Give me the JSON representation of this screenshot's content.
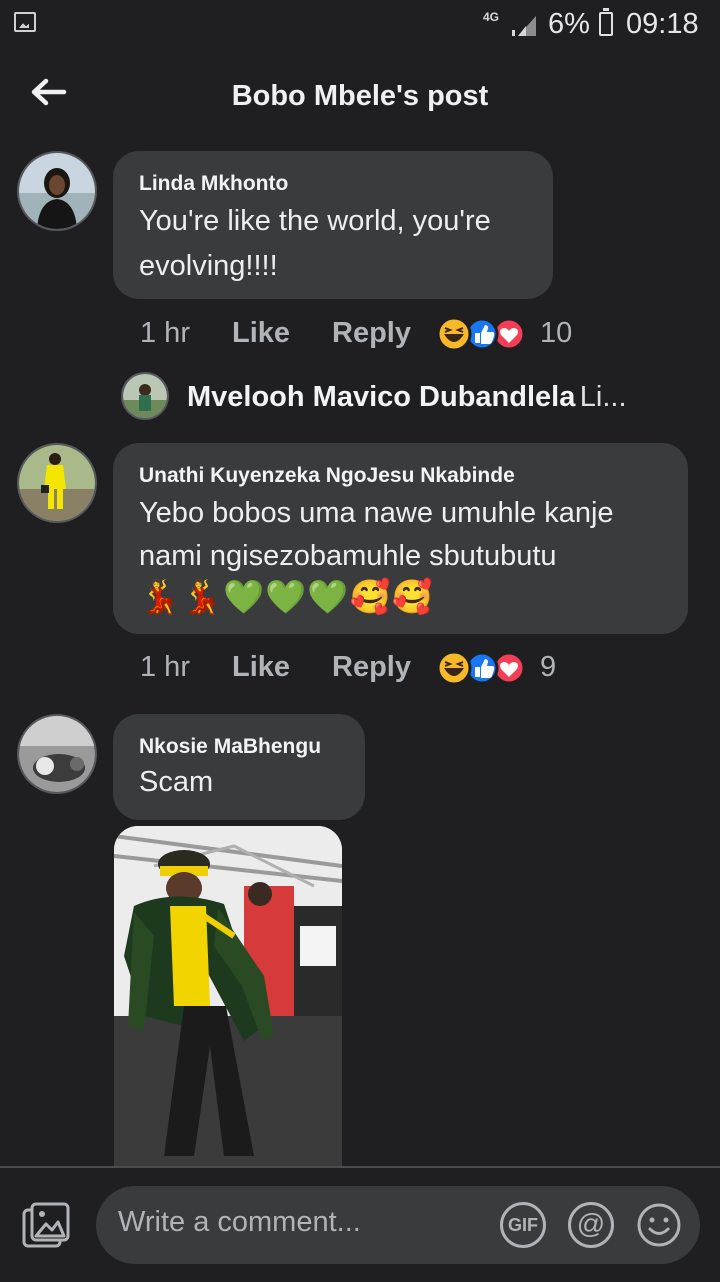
{
  "status_bar": {
    "network": "4G",
    "battery": "6%",
    "time": "09:18"
  },
  "header": {
    "title": "Bobo Mbele's post"
  },
  "comments": [
    {
      "name": "Linda Mkhonto",
      "line1": "You're like the world, you're",
      "line2": "evolving!!!!",
      "time": "1 hr",
      "like": "Like",
      "reply": "Reply",
      "reaction_count": "10",
      "reply_preview": {
        "name": "Mvelooh Mavico Dubandlela",
        "text": "Li..."
      }
    },
    {
      "name": "Unathi Kuyenzeka NgoJesu Nkabinde",
      "line1": "Yebo bobos uma nawe umuhle kanje",
      "line2": "nami ngisezobamuhle sbutubutu",
      "emojis": "💃💃💚💚💚🥰🥰",
      "time": "1 hr",
      "like": "Like",
      "reply": "Reply",
      "reaction_count": "9"
    },
    {
      "name": "Nkosie MaBhengu",
      "line1": "Scam"
    }
  ],
  "composer": {
    "placeholder": "Write a comment...",
    "gif": "GIF",
    "at": "@"
  },
  "colors": {
    "background": "#1f1f21",
    "bubble": "#3a3b3d",
    "muted": "#b0b3b8",
    "like_blue": "#1877f2",
    "love_red": "#f33e58",
    "haha_yellow": "#f7b928"
  }
}
